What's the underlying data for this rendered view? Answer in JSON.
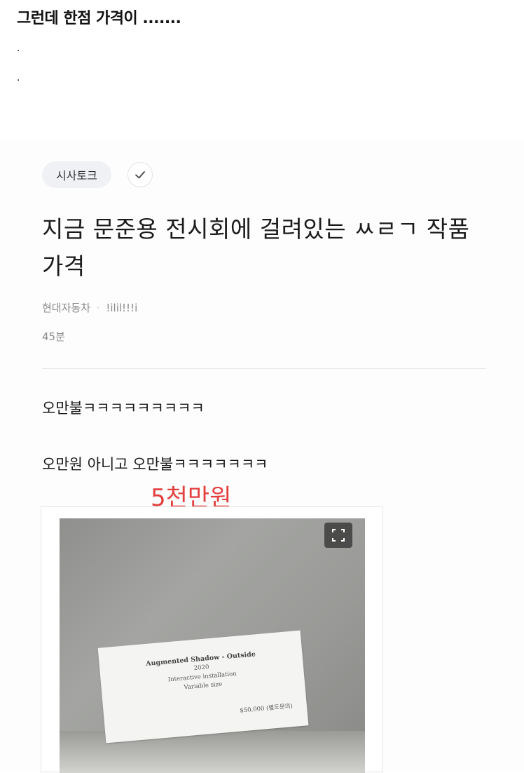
{
  "intro": {
    "heading": "그런데 한점 가격이 .......",
    "dot1": ".",
    "dot2": "."
  },
  "post": {
    "category": "시사토크",
    "check_icon": "check-icon",
    "title": "지금 문준용 전시회에 걸려있는 ㅆㄹㄱ 작품 가격",
    "author": "현대자동차",
    "separator": "·",
    "nickname": "!ilil!!!i",
    "time": "45분",
    "body_line1": "오만불ㅋㅋㅋㅋㅋㅋㅋㅋㅋ",
    "body_line2": "오만원 아니고 오만불ㅋㅋㅋㅋㅋㅋㅋ",
    "annotation": "5천만원",
    "annotation_color": "#e2403f"
  },
  "image": {
    "expand_icon": "expand-icon",
    "placard": {
      "title": "Augmented Shadow - Outside",
      "year": "2020",
      "medium": "Interactive installation",
      "size": "Variable size",
      "price": "$50,000 (별도문의)"
    }
  }
}
